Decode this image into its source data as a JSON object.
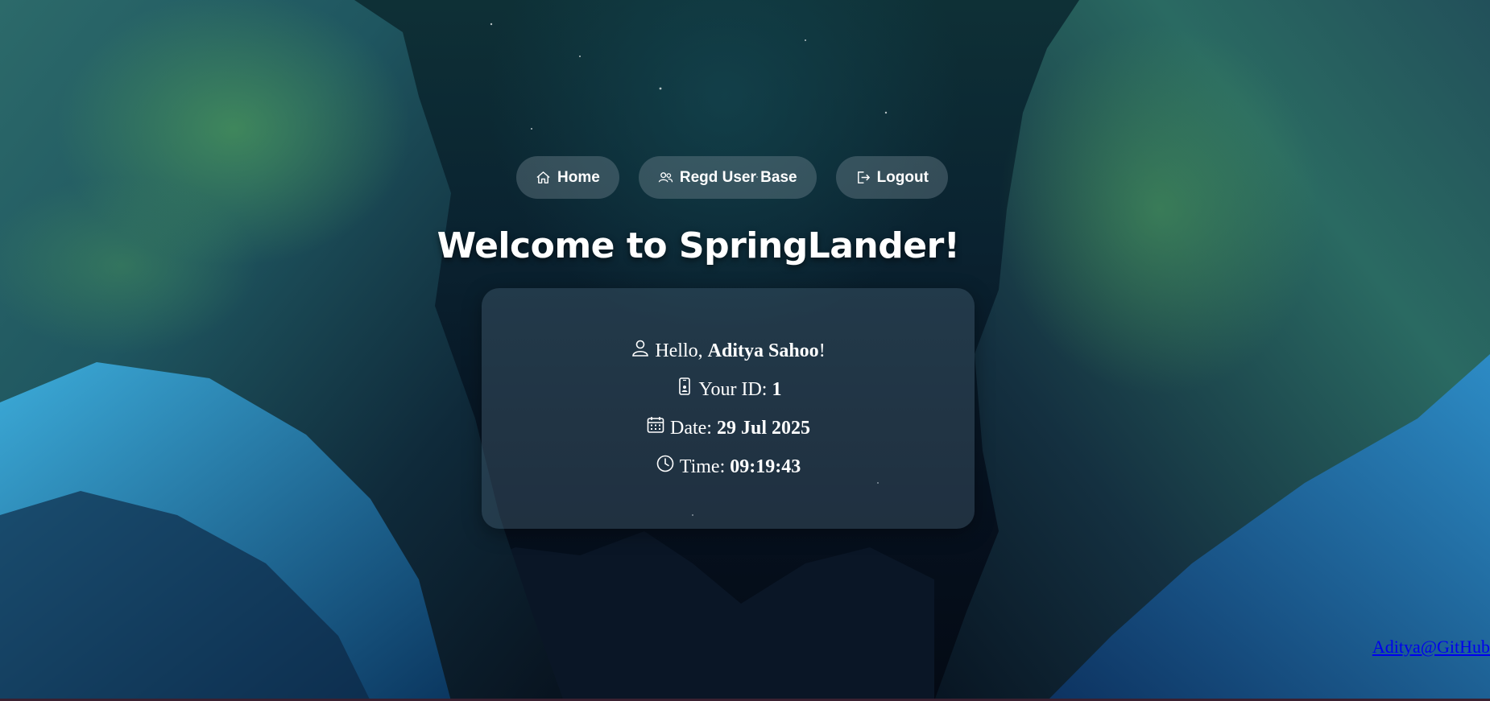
{
  "nav": {
    "items": [
      {
        "label": "Home",
        "icon": "home-icon"
      },
      {
        "label": "Regd User Base",
        "icon": "users-icon"
      },
      {
        "label": "Logout",
        "icon": "logout-icon"
      }
    ]
  },
  "title": "Welcome to SpringLander!",
  "card": {
    "greeting_prefix": "Hello, ",
    "user_name": "Aditya Sahoo",
    "greeting_suffix": "!",
    "id_label": "Your ID: ",
    "id_value": "1",
    "date_label": "Date: ",
    "date_value": "29 Jul 2025",
    "time_label": "Time: ",
    "time_value": "09:19:43",
    "icons": [
      "person-icon",
      "phone-icon",
      "calendar-icon",
      "clock-icon"
    ]
  },
  "footer": {
    "github_link": "Aditya@GitHub"
  },
  "colors": {
    "nav_button_bg": "#7a8c96",
    "link": "#0000ee",
    "text": "#ffffff"
  }
}
